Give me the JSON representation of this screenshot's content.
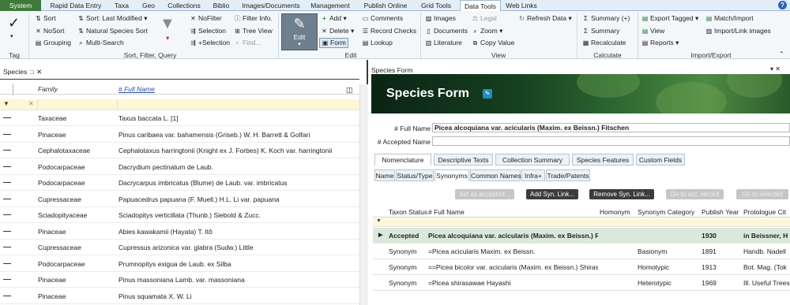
{
  "menu": {
    "items": [
      "System",
      "Rapid Data Entry",
      "Taxa",
      "Geo",
      "Collections",
      "Biblio",
      "Images/Documents",
      "Management",
      "Publish Online",
      "Grid Tools",
      "Data Tools",
      "Web Links"
    ],
    "active": "Data Tools"
  },
  "ribbon": {
    "tag": {
      "label": "Tag"
    },
    "sort": {
      "sort": "Sort",
      "nosort": "NoSort",
      "grouping": "Grouping",
      "sort_last": "Sort: Last Modified",
      "natural": "Natural Species Sort",
      "multi": "Multi-Search",
      "group_label": "Sort, Filter, Query"
    },
    "filter": {
      "nofilter": "NoFilter",
      "selection": "Selection",
      "plus_selection": "+Selection",
      "filter_info": "Filter Info.",
      "tree_view": "Tree View",
      "find": "Find..."
    },
    "edit": {
      "edit": "Edit",
      "add": "Add",
      "delete": "Delete",
      "form": "Form",
      "comments": "Comments",
      "record_checks": "Record Checks",
      "lookup": "Lookup",
      "group_label": "Edit"
    },
    "view": {
      "images": "Images",
      "documents": "Documents",
      "literature": "Literature",
      "legal": "Legal",
      "zoom": "Zoom",
      "copy_value": "Copy Value",
      "refresh": "Refresh Data",
      "group_label": "View"
    },
    "calc": {
      "summary_plus": "Summary (+)",
      "summary": "Summary",
      "recalculate": "Recalculate",
      "group_label": "Calculate"
    },
    "export": {
      "export_tagged": "Export Tagged",
      "view": "View",
      "reports": "Reports",
      "match_import": "Match/Import",
      "import_link": "Import/Link images",
      "group_label": "Import/Export"
    }
  },
  "left": {
    "tab": "Species",
    "col_family": "Family",
    "col_fullname": "# Full Name",
    "rows": [
      {
        "family": "Taxaceae",
        "name": "Taxus baccata L. [1]"
      },
      {
        "family": "Pinaceae",
        "name": "Pinus caribaea var. bahamensis (Griseb.) W. H. Barrett & Golfari"
      },
      {
        "family": "Cephalotaxaceae",
        "name": "Cephalotaxus harringtonii (Knight ex J. Forbes) K. Koch var. harringtonii"
      },
      {
        "family": "Podocarpaceae",
        "name": "Dacrydium pectinatum de Laub."
      },
      {
        "family": "Podocarpaceae",
        "name": "Dacrycarpus imbricatus (Blume) de Laub. var. imbricatus"
      },
      {
        "family": "Cupressaceae",
        "name": "Papuacedrus papuana (F. Muell.) H.L. Li var. papuana"
      },
      {
        "family": "Sciadopityaceae",
        "name": "Sciadopitys verticillata (Thunb.) Siebold & Zucc."
      },
      {
        "family": "Pinaceae",
        "name": "Abies kawakamii (Hayata) T. Itô"
      },
      {
        "family": "Cupressaceae",
        "name": "Cupressus arizonica var. glabra (Sudw.) Little"
      },
      {
        "family": "Podocarpaceae",
        "name": "Prumnopitys exigua de Laub. ex Silba"
      },
      {
        "family": "Pinaceae",
        "name": "Pinus massoniana Lamb. var. massoniana"
      },
      {
        "family": "Pinaceae",
        "name": "Pinus squamata X. W. Li"
      }
    ]
  },
  "right": {
    "header": "Species Form",
    "title": "Species Form",
    "full_name_label": "# Full Name",
    "full_name_value": "Picea alcoquiana var. acicularis (Maxim. ex Beissn.) Fitschen",
    "accepted_label": "# Accepted Name",
    "accepted_value": "",
    "tabs": [
      "Nomenclature",
      "Descriptive Texts",
      "Collection Summary",
      "Species Features",
      "Custom Fields"
    ],
    "subtabs": [
      "Name",
      "Status/Type",
      "Synonyms",
      "Common Names",
      "Infra+",
      "Trade/Patents"
    ],
    "buttons": [
      "Set as accepted...",
      "Add Syn. Link...",
      "Remove Syn. Link...",
      "Go to acc. record",
      "Go to selected"
    ],
    "syn_cols": [
      "Taxon Status",
      "# Full Name",
      "Homonym",
      "Synonym Category",
      "Publish Year",
      "Protologue Cit"
    ],
    "syn_rows": [
      {
        "status": "Accepted",
        "name": "Picea alcoquiana var. acicularis (Maxim. ex Beissn.) Fi...",
        "homonym": "",
        "category": "",
        "year": "1930",
        "proto": "in Beissner, H"
      },
      {
        "status": "Synonym",
        "name": "=Picea acicularis Maxim. ex Beissn.",
        "homonym": "",
        "category": "Basionym",
        "year": "1891",
        "proto": "Handb. Nadell"
      },
      {
        "status": "Synonym",
        "name": "==Picea bicolor var. acicularis (Maxim. ex Beissn.) Shiras.",
        "homonym": "",
        "category": "Homotypic",
        "year": "1913",
        "proto": "Bot. Mag. (Tok"
      },
      {
        "status": "Synonym",
        "name": "=Picea shirasawae Hayashi",
        "homonym": "",
        "category": "Heterotypic",
        "year": "1969",
        "proto": "Ill. Useful Trees"
      }
    ]
  }
}
